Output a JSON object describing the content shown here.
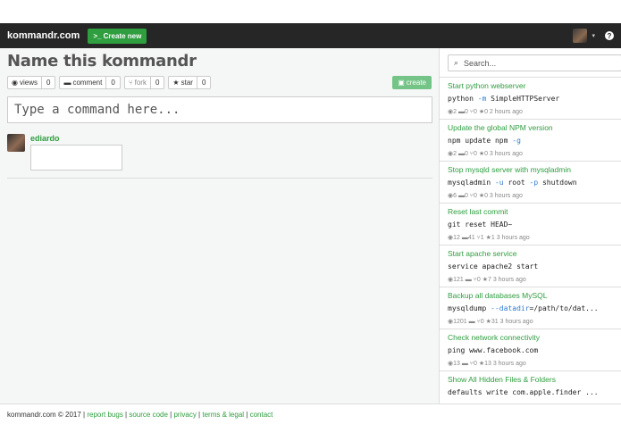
{
  "navbar": {
    "brand": "kommandr.com",
    "new_button": ">_ Create new"
  },
  "main": {
    "title": "Name this kommandr",
    "actions": [
      {
        "icon": "eye-icon",
        "label": "views",
        "count": "0"
      },
      {
        "icon": "comment-icon",
        "label": "comment",
        "count": "0"
      },
      {
        "icon": "fork-icon",
        "label": "fork",
        "count": "0"
      },
      {
        "icon": "star-icon",
        "label": "star",
        "count": "0"
      }
    ],
    "create_button": "create",
    "command_placeholder": "Type a command here...",
    "comment": {
      "username": "ediardo"
    }
  },
  "sidebar": {
    "search_placeholder": "Search...",
    "items": [
      {
        "title": "Start python webserver",
        "cmd": [
          "python ",
          "-m",
          " SimpleHTTPServer"
        ],
        "meta": "◉2  ▬0  ⑂0  ★0   2 hours ago"
      },
      {
        "title": "Update the global NPM version",
        "cmd": [
          "npm update npm ",
          "-g",
          ""
        ],
        "meta": "◉2  ▬0  ⑂0  ★0   3 hours ago"
      },
      {
        "title": "Stop mysqld server with mysqladmin",
        "cmd": [
          "mysqladmin ",
          "-u",
          " root ",
          "-p",
          " shutdown"
        ],
        "meta": "◉6  ▬0  ⑂0  ★0   3 hours ago"
      },
      {
        "title": "Reset last commit",
        "cmd": [
          "git reset HEAD~",
          "",
          ""
        ],
        "meta": "◉12  ▬41  ⑂1  ★1   3 hours ago"
      },
      {
        "title": "Start apache service",
        "cmd": [
          "service apache2 start",
          "",
          ""
        ],
        "meta": "◉121  ▬  ⑂0  ★7   3 hours ago"
      },
      {
        "title": "Backup all databases MySQL",
        "cmd": [
          "mysqldump ",
          "--datadir",
          "=/path/to/dat..."
        ],
        "meta": "◉1201  ▬  ⑂0  ★31   3 hours ago"
      },
      {
        "title": "Check network connectivity",
        "cmd": [
          "ping www.facebook.com",
          "",
          ""
        ],
        "meta": "◉13  ▬  ⑂0  ★13   3 hours ago"
      },
      {
        "title": "Show All Hidden Files & Folders",
        "cmd": [
          "defaults write com.apple.finder ...",
          "",
          ""
        ],
        "meta": ""
      }
    ]
  },
  "footer": {
    "copyright": "kommandr.com © 2017",
    "links": [
      "report bugs",
      "source code",
      "privacy",
      "terms & legal",
      "contact"
    ]
  }
}
